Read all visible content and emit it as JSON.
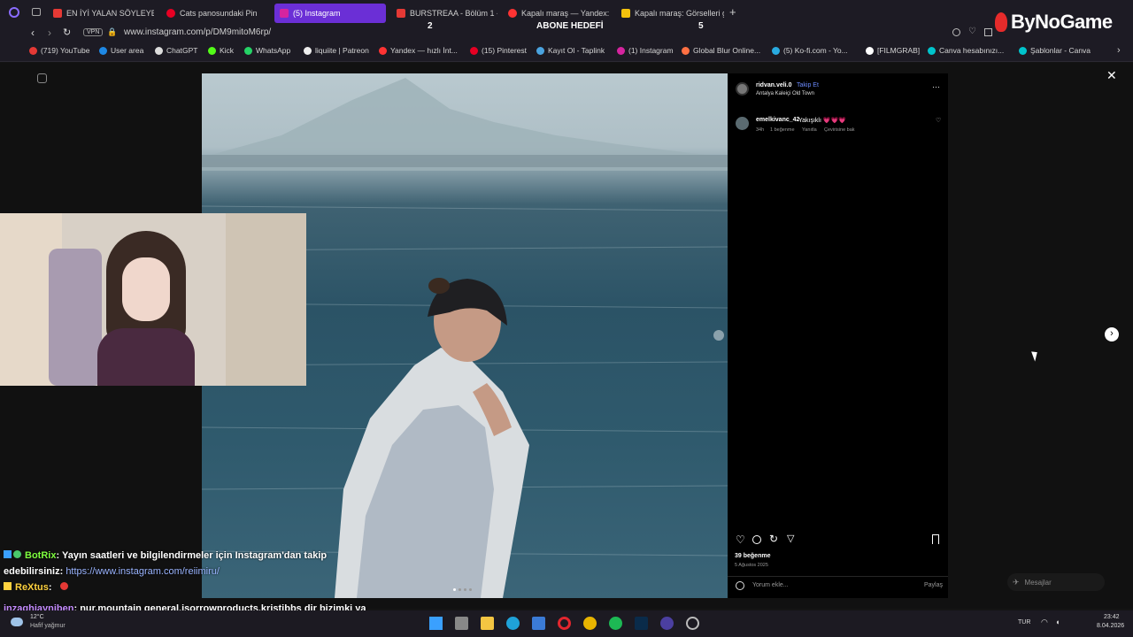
{
  "browser": {
    "tabs": [
      {
        "label": "EN İYİ YALAN SÖYLEYEN",
        "color": "#e53935"
      },
      {
        "label": "Cats panosundaki Pin",
        "color": "#e60023"
      },
      {
        "label": "(5) Instagram",
        "color": "#d6249f"
      },
      {
        "label": "BURSTREAA - Bölüm 1 - T",
        "color": "#e53935"
      },
      {
        "label": "Kapalı maraş — Yandex: I",
        "color": "#ff3333"
      },
      {
        "label": "Kapalı maraş: Görselleri g",
        "color": "#f4c20d"
      }
    ],
    "url": "www.instagram.com/p/DM9mitoM6rp/",
    "vpn_label": "VPN",
    "bookmarks": [
      {
        "label": "(719) YouTube",
        "color": "#e53935"
      },
      {
        "label": "User area",
        "color": "#1e88e5"
      },
      {
        "label": "ChatGPT",
        "color": "#dddddd"
      },
      {
        "label": "Kick",
        "color": "#53fc18"
      },
      {
        "label": "WhatsApp",
        "color": "#25d366"
      },
      {
        "label": "liquiite | Patreon",
        "color": "#eeeeee"
      },
      {
        "label": "Yandex — hızlı İnt...",
        "color": "#ff3333"
      },
      {
        "label": "(15) Pinterest",
        "color": "#e60023"
      },
      {
        "label": "Kayıt Ol - Taplink",
        "color": "#4aa3df"
      },
      {
        "label": "(1) Instagram",
        "color": "#d6249f"
      },
      {
        "label": "Global Blur Online...",
        "color": "#ff7043"
      },
      {
        "label": "(5) Ko-fi.com - Yo...",
        "color": "#29abe0"
      },
      {
        "label": "[FILMGRAB]",
        "color": "#ffffff"
      },
      {
        "label": "Canva hesabınızı...",
        "color": "#00c4cc"
      },
      {
        "label": "Şablonlar - Canva",
        "color": "#00c4cc"
      }
    ]
  },
  "stream": {
    "goal_left": "2",
    "goal_label": "ABONE HEDEFİ",
    "goal_right": "5",
    "logo": "ByNoGame"
  },
  "post": {
    "username": "ridvan.veli.0",
    "follow_label": "Takip Et",
    "location": "Antalya Kaleiçi Old Town",
    "comment_user": "emelkivanc_42",
    "comment_text": "Yakışıklı 💗💗💗",
    "comment_time": "34h",
    "comment_likes": "1 beğenme",
    "comment_reply": "Yanıtla",
    "comment_translate": "Çevirisine bak",
    "likes": "39 beğenme",
    "date": "5 Ağustos 2025",
    "comment_placeholder": "Yorum ekle...",
    "share_label": "Paylaş",
    "messages_label": "Mesajlar"
  },
  "chat": [
    {
      "user": "BotRix",
      "user_color": "#7fff3f",
      "text": ": Yayın saatleri ve bilgilendirmeler için Instagram'dan takip edebilirsiniz:",
      "link": "https://www.instagram.com/reiimiru/"
    },
    {
      "user": "ReXtus",
      "user_color": "#ffd23f",
      "text": ":"
    },
    {
      "user": "inzaghiayniben",
      "user_color": "#c58cff",
      "text": ": nur,mountain general,isorrowproducts,kristibbs dir bizimki ya"
    }
  ],
  "taskbar": {
    "weather_temp": "12°C",
    "weather_text": "Hafif yağmur",
    "lang": "TUR",
    "time": "23:42",
    "date": "8.04.2026"
  }
}
